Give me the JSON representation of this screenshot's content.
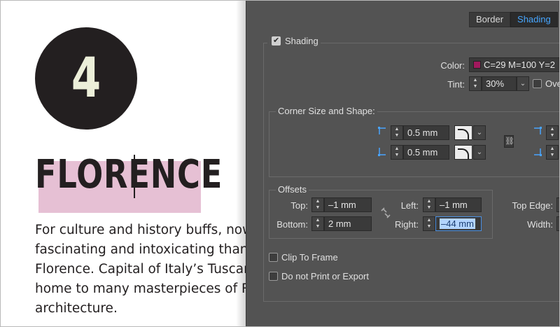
{
  "document": {
    "number": "4",
    "title": "FLORENCE",
    "body_lines": [
      "For culture and history buffs, now",
      "fascinating and intoxicating than",
      "Florence. Capital of Italy’s Tuscany",
      "home to many masterpieces of R",
      "architecture."
    ]
  },
  "dialog": {
    "tabs": [
      "Border",
      "Shading"
    ],
    "active_tab": "Shading",
    "shading_label": "Shading",
    "color_label": "Color:",
    "color_value": "C=29 M=100 Y=2",
    "color_swatch": "#a1195d",
    "tint_label": "Tint:",
    "tint_value": "30%",
    "overprint_label": "Ove",
    "corner_section": "Corner Size and Shape:",
    "corner_top_value": "0.5 mm",
    "corner_bottom_value": "0.5 mm",
    "offsets_section": "Offsets",
    "top_label": "Top:",
    "top_value": "–1 mm",
    "bottom_label": "Bottom:",
    "bottom_value": "2 mm",
    "left_label": "Left:",
    "left_value": "–1 mm",
    "right_label": "Right:",
    "right_value": "–44 mm",
    "top_edge_label": "Top Edge:",
    "width_label": "Width:",
    "clip_label": "Clip To Frame",
    "no_print_label": "Do not Print or Export"
  }
}
